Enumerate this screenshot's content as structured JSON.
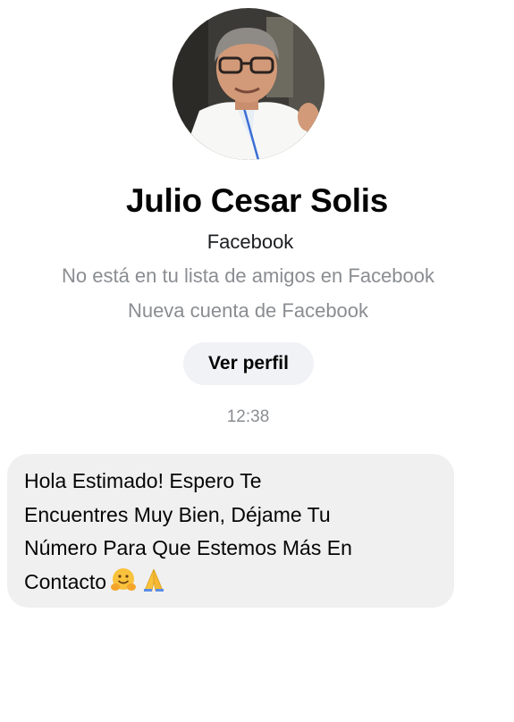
{
  "contact": {
    "name": "Julio Cesar Solis",
    "source": "Facebook",
    "friend_status": "No está en tu lista de amigos en Facebook",
    "account_note": "Nueva cuenta de Facebook"
  },
  "actions": {
    "view_profile_label": "Ver perfil"
  },
  "thread": {
    "timestamp": "12:38",
    "messages": [
      {
        "lines": [
          "Hola Estimado! Espero Te",
          "Encuentres Muy Bien, Déjame Tu",
          "Número Para Que Estemos Más En",
          "Contacto"
        ],
        "emojis": [
          "hugging-face",
          "folded-hands"
        ]
      }
    ]
  }
}
